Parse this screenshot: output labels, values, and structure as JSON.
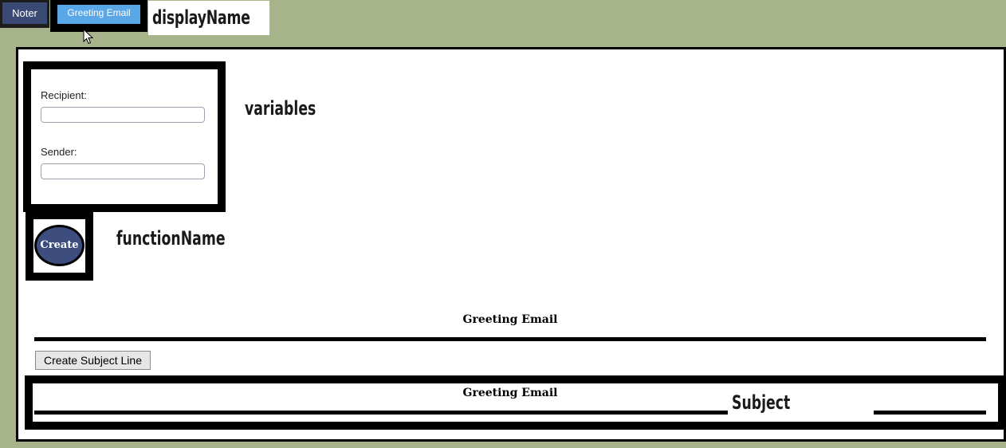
{
  "tabs": [
    {
      "label": "Noter"
    },
    {
      "label": "Greeting Email"
    }
  ],
  "display_name_label": "displayName",
  "variables": {
    "title": "variables",
    "fields": [
      {
        "label": "Recipient:",
        "value": ""
      },
      {
        "label": "Sender:",
        "value": ""
      }
    ]
  },
  "function": {
    "button_label": "Create",
    "title": "functionName"
  },
  "output": {
    "heading": "Greeting Email",
    "subject_button_label": "Create Subject Line",
    "subject_heading": "Greeting Email",
    "subject_label": "Subject"
  },
  "icons": {
    "cursor": "mouse-pointer-icon"
  },
  "colors": {
    "background": "#a7b48b",
    "tab_noter": "#3b4a75",
    "tab_active": "#5aa7e8",
    "create_button": "#3d4d7e"
  }
}
